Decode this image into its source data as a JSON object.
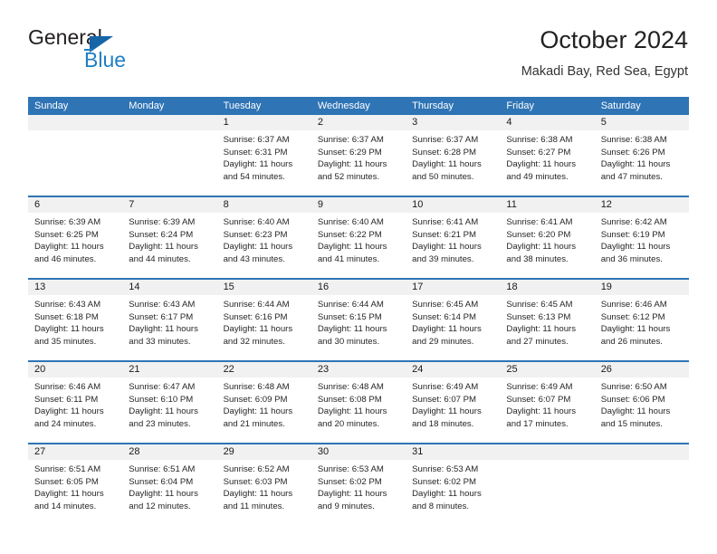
{
  "brand": {
    "word_one": "General",
    "word_two": "Blue",
    "triangle_color": "#1565a8",
    "blue_color": "#1f7ec4"
  },
  "header": {
    "title": "October 2024",
    "subtitle": "Makadi Bay, Red Sea, Egypt"
  },
  "theme": {
    "header_bg": "#2f74b5",
    "daynum_bg": "#f1f1f1",
    "rule_color": "#2f74b5",
    "text_color": "#262626"
  },
  "calendar": {
    "weekday_headers": [
      "Sunday",
      "Monday",
      "Tuesday",
      "Wednesday",
      "Thursday",
      "Friday",
      "Saturday"
    ],
    "weeks": [
      {
        "days": [
          {
            "num": "",
            "sunrise": "",
            "sunset": "",
            "daylight_a": "",
            "daylight_b": "",
            "empty": true
          },
          {
            "num": "",
            "sunrise": "",
            "sunset": "",
            "daylight_a": "",
            "daylight_b": "",
            "empty": true
          },
          {
            "num": "1",
            "sunrise": "Sunrise: 6:37 AM",
            "sunset": "Sunset: 6:31 PM",
            "daylight_a": "Daylight: 11 hours",
            "daylight_b": "and 54 minutes.",
            "empty": false
          },
          {
            "num": "2",
            "sunrise": "Sunrise: 6:37 AM",
            "sunset": "Sunset: 6:29 PM",
            "daylight_a": "Daylight: 11 hours",
            "daylight_b": "and 52 minutes.",
            "empty": false
          },
          {
            "num": "3",
            "sunrise": "Sunrise: 6:37 AM",
            "sunset": "Sunset: 6:28 PM",
            "daylight_a": "Daylight: 11 hours",
            "daylight_b": "and 50 minutes.",
            "empty": false
          },
          {
            "num": "4",
            "sunrise": "Sunrise: 6:38 AM",
            "sunset": "Sunset: 6:27 PM",
            "daylight_a": "Daylight: 11 hours",
            "daylight_b": "and 49 minutes.",
            "empty": false
          },
          {
            "num": "5",
            "sunrise": "Sunrise: 6:38 AM",
            "sunset": "Sunset: 6:26 PM",
            "daylight_a": "Daylight: 11 hours",
            "daylight_b": "and 47 minutes.",
            "empty": false
          }
        ]
      },
      {
        "days": [
          {
            "num": "6",
            "sunrise": "Sunrise: 6:39 AM",
            "sunset": "Sunset: 6:25 PM",
            "daylight_a": "Daylight: 11 hours",
            "daylight_b": "and 46 minutes.",
            "empty": false
          },
          {
            "num": "7",
            "sunrise": "Sunrise: 6:39 AM",
            "sunset": "Sunset: 6:24 PM",
            "daylight_a": "Daylight: 11 hours",
            "daylight_b": "and 44 minutes.",
            "empty": false
          },
          {
            "num": "8",
            "sunrise": "Sunrise: 6:40 AM",
            "sunset": "Sunset: 6:23 PM",
            "daylight_a": "Daylight: 11 hours",
            "daylight_b": "and 43 minutes.",
            "empty": false
          },
          {
            "num": "9",
            "sunrise": "Sunrise: 6:40 AM",
            "sunset": "Sunset: 6:22 PM",
            "daylight_a": "Daylight: 11 hours",
            "daylight_b": "and 41 minutes.",
            "empty": false
          },
          {
            "num": "10",
            "sunrise": "Sunrise: 6:41 AM",
            "sunset": "Sunset: 6:21 PM",
            "daylight_a": "Daylight: 11 hours",
            "daylight_b": "and 39 minutes.",
            "empty": false
          },
          {
            "num": "11",
            "sunrise": "Sunrise: 6:41 AM",
            "sunset": "Sunset: 6:20 PM",
            "daylight_a": "Daylight: 11 hours",
            "daylight_b": "and 38 minutes.",
            "empty": false
          },
          {
            "num": "12",
            "sunrise": "Sunrise: 6:42 AM",
            "sunset": "Sunset: 6:19 PM",
            "daylight_a": "Daylight: 11 hours",
            "daylight_b": "and 36 minutes.",
            "empty": false
          }
        ]
      },
      {
        "days": [
          {
            "num": "13",
            "sunrise": "Sunrise: 6:43 AM",
            "sunset": "Sunset: 6:18 PM",
            "daylight_a": "Daylight: 11 hours",
            "daylight_b": "and 35 minutes.",
            "empty": false
          },
          {
            "num": "14",
            "sunrise": "Sunrise: 6:43 AM",
            "sunset": "Sunset: 6:17 PM",
            "daylight_a": "Daylight: 11 hours",
            "daylight_b": "and 33 minutes.",
            "empty": false
          },
          {
            "num": "15",
            "sunrise": "Sunrise: 6:44 AM",
            "sunset": "Sunset: 6:16 PM",
            "daylight_a": "Daylight: 11 hours",
            "daylight_b": "and 32 minutes.",
            "empty": false
          },
          {
            "num": "16",
            "sunrise": "Sunrise: 6:44 AM",
            "sunset": "Sunset: 6:15 PM",
            "daylight_a": "Daylight: 11 hours",
            "daylight_b": "and 30 minutes.",
            "empty": false
          },
          {
            "num": "17",
            "sunrise": "Sunrise: 6:45 AM",
            "sunset": "Sunset: 6:14 PM",
            "daylight_a": "Daylight: 11 hours",
            "daylight_b": "and 29 minutes.",
            "empty": false
          },
          {
            "num": "18",
            "sunrise": "Sunrise: 6:45 AM",
            "sunset": "Sunset: 6:13 PM",
            "daylight_a": "Daylight: 11 hours",
            "daylight_b": "and 27 minutes.",
            "empty": false
          },
          {
            "num": "19",
            "sunrise": "Sunrise: 6:46 AM",
            "sunset": "Sunset: 6:12 PM",
            "daylight_a": "Daylight: 11 hours",
            "daylight_b": "and 26 minutes.",
            "empty": false
          }
        ]
      },
      {
        "days": [
          {
            "num": "20",
            "sunrise": "Sunrise: 6:46 AM",
            "sunset": "Sunset: 6:11 PM",
            "daylight_a": "Daylight: 11 hours",
            "daylight_b": "and 24 minutes.",
            "empty": false
          },
          {
            "num": "21",
            "sunrise": "Sunrise: 6:47 AM",
            "sunset": "Sunset: 6:10 PM",
            "daylight_a": "Daylight: 11 hours",
            "daylight_b": "and 23 minutes.",
            "empty": false
          },
          {
            "num": "22",
            "sunrise": "Sunrise: 6:48 AM",
            "sunset": "Sunset: 6:09 PM",
            "daylight_a": "Daylight: 11 hours",
            "daylight_b": "and 21 minutes.",
            "empty": false
          },
          {
            "num": "23",
            "sunrise": "Sunrise: 6:48 AM",
            "sunset": "Sunset: 6:08 PM",
            "daylight_a": "Daylight: 11 hours",
            "daylight_b": "and 20 minutes.",
            "empty": false
          },
          {
            "num": "24",
            "sunrise": "Sunrise: 6:49 AM",
            "sunset": "Sunset: 6:07 PM",
            "daylight_a": "Daylight: 11 hours",
            "daylight_b": "and 18 minutes.",
            "empty": false
          },
          {
            "num": "25",
            "sunrise": "Sunrise: 6:49 AM",
            "sunset": "Sunset: 6:07 PM",
            "daylight_a": "Daylight: 11 hours",
            "daylight_b": "and 17 minutes.",
            "empty": false
          },
          {
            "num": "26",
            "sunrise": "Sunrise: 6:50 AM",
            "sunset": "Sunset: 6:06 PM",
            "daylight_a": "Daylight: 11 hours",
            "daylight_b": "and 15 minutes.",
            "empty": false
          }
        ]
      },
      {
        "days": [
          {
            "num": "27",
            "sunrise": "Sunrise: 6:51 AM",
            "sunset": "Sunset: 6:05 PM",
            "daylight_a": "Daylight: 11 hours",
            "daylight_b": "and 14 minutes.",
            "empty": false
          },
          {
            "num": "28",
            "sunrise": "Sunrise: 6:51 AM",
            "sunset": "Sunset: 6:04 PM",
            "daylight_a": "Daylight: 11 hours",
            "daylight_b": "and 12 minutes.",
            "empty": false
          },
          {
            "num": "29",
            "sunrise": "Sunrise: 6:52 AM",
            "sunset": "Sunset: 6:03 PM",
            "daylight_a": "Daylight: 11 hours",
            "daylight_b": "and 11 minutes.",
            "empty": false
          },
          {
            "num": "30",
            "sunrise": "Sunrise: 6:53 AM",
            "sunset": "Sunset: 6:02 PM",
            "daylight_a": "Daylight: 11 hours",
            "daylight_b": "and 9 minutes.",
            "empty": false
          },
          {
            "num": "31",
            "sunrise": "Sunrise: 6:53 AM",
            "sunset": "Sunset: 6:02 PM",
            "daylight_a": "Daylight: 11 hours",
            "daylight_b": "and 8 minutes.",
            "empty": false
          },
          {
            "num": "",
            "sunrise": "",
            "sunset": "",
            "daylight_a": "",
            "daylight_b": "",
            "empty": true
          },
          {
            "num": "",
            "sunrise": "",
            "sunset": "",
            "daylight_a": "",
            "daylight_b": "",
            "empty": true
          }
        ]
      }
    ]
  }
}
